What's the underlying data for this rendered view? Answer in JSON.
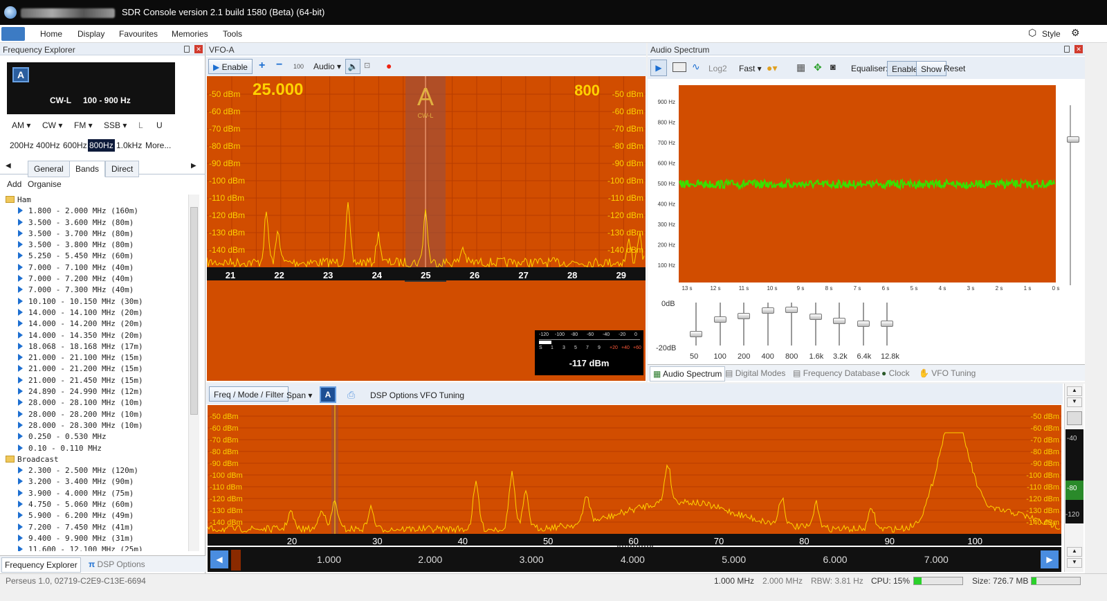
{
  "window": {
    "title": "SDR Console version 2.1 build 1580 (Beta) (64-bit)"
  },
  "menu": {
    "items": [
      "Home",
      "Display",
      "Favourites",
      "Memories",
      "Tools"
    ],
    "style": "Style"
  },
  "freq_explorer": {
    "title": "Frequency Explorer",
    "vfo_letter": "A",
    "mode_text": "CW-L",
    "range_text": "100 - 900 Hz",
    "modes": [
      "AM",
      "CW",
      "FM",
      "SSB",
      "L",
      "U"
    ],
    "bandwidths": [
      "200Hz",
      "400Hz",
      "600Hz",
      "800Hz",
      "1.0kHz",
      "More..."
    ],
    "selected_bandwidth": "800Hz",
    "tabs": [
      "General",
      "Bands",
      "Direct"
    ],
    "actions": [
      "Add",
      "Organise"
    ],
    "groups": [
      {
        "name": "Ham",
        "items": [
          "1.800 - 2.000 MHz (160m)",
          "3.500 - 3.600 MHz (80m)",
          "3.500 - 3.700 MHz (80m)",
          "3.500 - 3.800 MHz (80m)",
          "5.250 - 5.450 MHz (60m)",
          "7.000 - 7.100 MHz (40m)",
          "7.000 - 7.200 MHz (40m)",
          "7.000 - 7.300 MHz (40m)",
          "10.100 - 10.150 MHz (30m)",
          "14.000 - 14.100 MHz (20m)",
          "14.000 - 14.200 MHz (20m)",
          "14.000 - 14.350 MHz (20m)",
          "18.068 - 18.168 MHz (17m)",
          "21.000 - 21.100 MHz (15m)",
          "21.000 - 21.200 MHz (15m)",
          "21.000 - 21.450 MHz (15m)",
          "24.890 - 24.990 MHz (12m)",
          "28.000 - 28.100 MHz (10m)",
          "28.000 - 28.200 MHz (10m)",
          "28.000 - 28.300 MHz (10m)",
          "0.250 - 0.530 MHz",
          "0.10 - 0.110 MHz"
        ]
      },
      {
        "name": "Broadcast",
        "items": [
          "2.300 - 2.500 MHz (120m)",
          "3.200 - 3.400 MHz (90m)",
          "3.900 - 4.000 MHz (75m)",
          "4.750 - 5.060 MHz (60m)",
          "5.900 - 6.200 MHz (49m)",
          "7.200 - 7.450 MHz (41m)",
          "9.400 - 9.900 MHz (31m)",
          "11.600 - 12.100 MHz (25m)"
        ]
      }
    ],
    "bottom_tabs": [
      "Frequency Explorer",
      "DSP Options"
    ]
  },
  "vfo": {
    "title": "VFO-A",
    "toolbar": {
      "enable": "Enable",
      "step": "100",
      "audio": "Audio"
    },
    "freq_left": "25.000",
    "freq_right": "800",
    "marker_letter": "A",
    "marker_mode": "CW-L",
    "db_labels": [
      "-50 dBm",
      "-60 dBm",
      "-70 dBm",
      "-80 dBm",
      "-90 dBm",
      "-100 dBm",
      "-110 dBm",
      "-120 dBm",
      "-130 dBm",
      "-140 dBm"
    ],
    "x_labels": [
      "21",
      "22",
      "23",
      "24",
      "25",
      "26",
      "27",
      "28",
      "29"
    ],
    "smeter": {
      "scale_top": [
        "-120",
        "-100",
        "-80",
        "-60",
        "-40",
        "-20",
        "0"
      ],
      "scale_bottom": [
        "S",
        "1",
        "3",
        "5",
        "7",
        "9",
        "+20",
        "+40",
        "+60"
      ],
      "value": "-117 dBm"
    }
  },
  "audio": {
    "title": "Audio Spectrum",
    "toolbar": {
      "log": "Log2",
      "speed": "Fast",
      "equaliser": "Equaliser:",
      "enable": "Enable",
      "show": "Show",
      "reset": "Reset"
    },
    "y_labels": [
      "900 Hz",
      "800 Hz",
      "700 Hz",
      "600 Hz",
      "500 Hz",
      "400 Hz",
      "300 Hz",
      "200 Hz",
      "100 Hz"
    ],
    "x_labels": [
      "13 s",
      "12 s",
      "11 s",
      "10 s",
      "9 s",
      "8 s",
      "7 s",
      "6 s",
      "5 s",
      "4 s",
      "3 s",
      "2 s",
      "1 s",
      "0 s"
    ],
    "eq": {
      "top": "0dB",
      "bottom": "-20dB",
      "bands": [
        "50",
        "100",
        "200",
        "400",
        "800",
        "1.6k",
        "3.2k",
        "6.4k",
        "12.8k"
      ],
      "levels": [
        0.3,
        0.65,
        0.75,
        0.88,
        0.9,
        0.72,
        0.62,
        0.55,
        0.55
      ]
    },
    "tabs": [
      "Audio Spectrum",
      "Digital Modes",
      "Frequency Database",
      "Clock",
      "VFO Tuning"
    ]
  },
  "main": {
    "toolbar": {
      "freq_mode": "Freq / Mode / Filter",
      "span": "Span",
      "vfo": "A",
      "dsp": "DSP Options",
      "tuning": "VFO Tuning"
    },
    "db_labels": [
      "-50 dBm",
      "-60 dBm",
      "-70 dBm",
      "-80 dBm",
      "-90 dBm",
      "-100 dBm",
      "-110 dBm",
      "-120 dBm",
      "-130 dBm",
      "-140 dBm"
    ],
    "x_labels": [
      "20",
      "30",
      "40",
      "50",
      "60",
      "70",
      "80",
      "90",
      "100"
    ],
    "band_labels": [
      "1.000",
      "2.000",
      "3.000",
      "4.000",
      "5.000",
      "6.000",
      "7.000"
    ],
    "meter_labels": [
      "-40",
      "-80",
      "-120"
    ]
  },
  "statusbar": {
    "device": "Perseus 1.0, 02719-C2E9-C13E-6694",
    "f1": "1.000 MHz",
    "f2": "2.000 MHz",
    "rbw": "RBW: 3.81 Hz",
    "cpu": "CPU: 15%",
    "cpu_level": 0.15,
    "size": "Size: 726.7 MB"
  },
  "colors": {
    "spectrum_bg": "#d14d00",
    "trace": "#ffd200",
    "waterfall_signal": "#39e000",
    "accent": "#1d6fd1"
  }
}
